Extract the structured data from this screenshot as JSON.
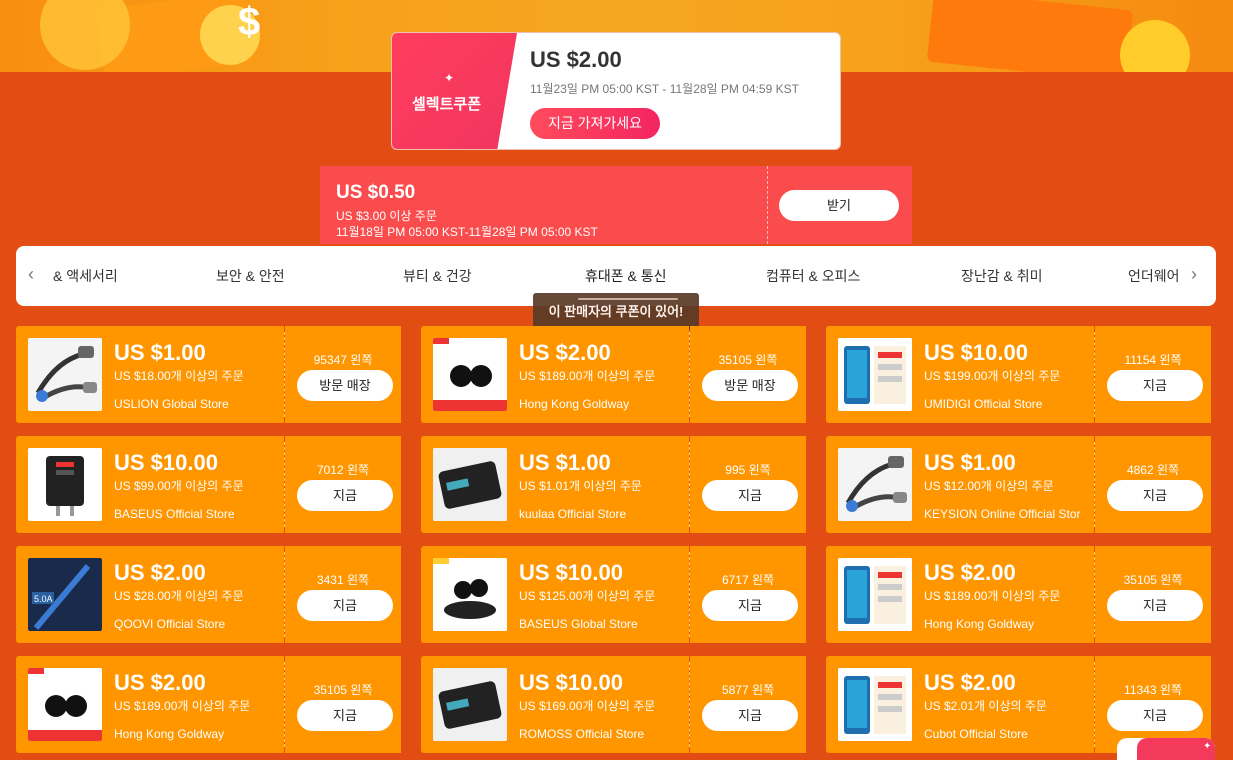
{
  "select_coupon": {
    "label": "셀렉트쿠폰",
    "amount": "US $2.00",
    "period": "11월23일 PM 05:00 KST - 11월28일 PM 04:59 KST",
    "button": "지금 가져가세요"
  },
  "store_coupon": {
    "amount": "US $0.50",
    "condition": "US $3.00 이상 주문",
    "period": "11월18일 PM 05:00 KST-11월28일 PM 05:00 KST",
    "button": "받기"
  },
  "categories": [
    "& 액세서리",
    "보안 & 안전",
    "뷰티 & 건강",
    "휴대폰 & 통신",
    "컴퓨터 & 오피스",
    "장난감 & 취미",
    "언더웨어"
  ],
  "active_category": "휴대폰 & 통신",
  "tooltip": "이 판매자의 쿠폰이 있어!",
  "coupons": [
    {
      "amount": "US $1.00",
      "min": "US $18.00개 이상의 주문",
      "store": "USLION Global Store",
      "left": "95347 왼쪽",
      "button": "방문 매장",
      "icon": "magnetic-cable-icon"
    },
    {
      "amount": "US $2.00",
      "min": "US $189.00개 이상의 주문",
      "store": "Hong Kong Goldway",
      "left": "35105 왼쪽",
      "button": "방문 매장",
      "icon": "earbuds-icon"
    },
    {
      "amount": "US $10.00",
      "min": "US $199.00개 이상의 주문",
      "store": "UMIDIGI Official Store",
      "left": "11154 왼쪽",
      "button": "지금",
      "icon": "smartphone-icon"
    },
    {
      "amount": "US $10.00",
      "min": "US $99.00개 이상의 주문",
      "store": "BASEUS Official Store",
      "left": "7012 왼쪽",
      "button": "지금",
      "icon": "charger-icon"
    },
    {
      "amount": "US $1.00",
      "min": "US $1.01개 이상의 주문",
      "store": "kuulaa Official Store",
      "left": "995 왼쪽",
      "button": "지금",
      "icon": "power-bank-icon"
    },
    {
      "amount": "US $1.00",
      "min": "US $12.00개 이상의 주문",
      "store": "KEYSION Online Official Stor",
      "left": "4862 왼쪽",
      "button": "지금",
      "icon": "magnetic-cable-icon"
    },
    {
      "amount": "US $2.00",
      "min": "US $28.00개 이상의 주문",
      "store": "QOOVI Official Store",
      "left": "3431 왼쪽",
      "button": "지금",
      "icon": "usb-cable-icon"
    },
    {
      "amount": "US $10.00",
      "min": "US $125.00개 이상의 주문",
      "store": "BASEUS Global Store",
      "left": "6717 왼쪽",
      "button": "지금",
      "icon": "wireless-earbuds-icon"
    },
    {
      "amount": "US $2.00",
      "min": "US $189.00개 이상의 주문",
      "store": "Hong Kong Goldway",
      "left": "35105 왼쪽",
      "button": "지금",
      "icon": "smartphone-icon"
    },
    {
      "amount": "US $2.00",
      "min": "US $189.00개 이상의 주문",
      "store": "Hong Kong Goldway",
      "left": "35105 왼쪽",
      "button": "지금",
      "icon": "earbuds-icon"
    },
    {
      "amount": "US $10.00",
      "min": "US $169.00개 이상의 주문",
      "store": "ROMOSS Official Store",
      "left": "5877 왼쪽",
      "button": "지금",
      "icon": "power-bank-icon"
    },
    {
      "amount": "US $2.00",
      "min": "US $2.01개 이상의 주문",
      "store": "Cubot Official Store",
      "left": "11343 왼쪽",
      "button": "지금",
      "icon": "smartphone-icon"
    }
  ],
  "colors": {
    "page_bg": "#e14d12",
    "coupon_orange": "#ff9600",
    "coupon_red": "#fb4c4d",
    "accent_pink": "#f32561"
  }
}
